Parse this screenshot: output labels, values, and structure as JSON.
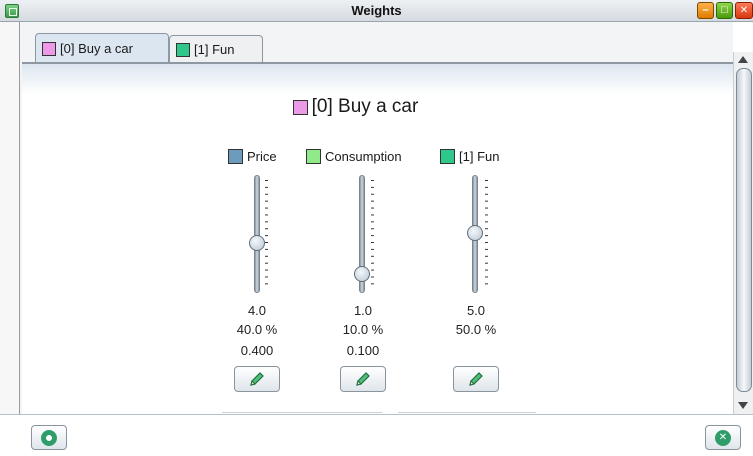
{
  "window": {
    "title": "Weights"
  },
  "tabs": [
    {
      "label": "[0] Buy a car",
      "color": "#ec9ae8",
      "active": true
    },
    {
      "label": "[1] Fun",
      "color": "#2fc78c",
      "active": false
    }
  ],
  "heading": {
    "label": "[0] Buy a car",
    "color": "#ec9ae8"
  },
  "criteria": [
    {
      "label": "Price",
      "color": "#6d9bbd",
      "value": "4.0",
      "percent": "40.0 %",
      "normalized": "0.400",
      "slider_level": 0.4
    },
    {
      "label": "Consumption",
      "color": "#8fea8a",
      "value": "1.0",
      "percent": "10.0 %",
      "normalized": "0.100",
      "slider_level": 0.1
    },
    {
      "label": "[1] Fun",
      "color": "#2fc78c",
      "value": "5.0",
      "percent": "50.0 %",
      "normalized": "",
      "slider_level": 0.5
    }
  ],
  "icons": {
    "edit": "pencil-icon",
    "help": "lifebuoy-icon",
    "cancel": "cancel-icon"
  }
}
